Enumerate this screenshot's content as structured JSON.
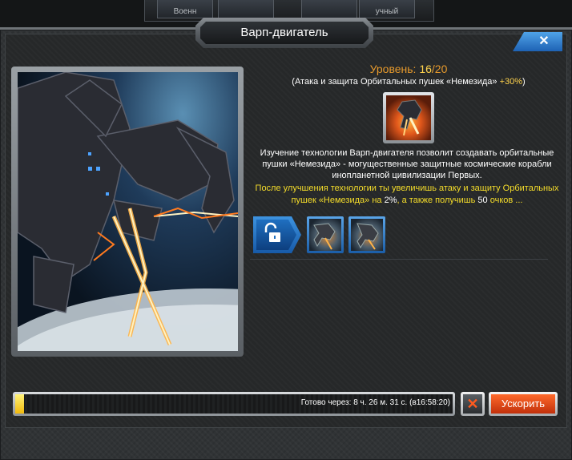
{
  "top_tabs": [
    "Военн",
    "",
    "",
    "учный"
  ],
  "window": {
    "title": "Варп-двигатель",
    "close_label": "✕"
  },
  "level": {
    "label": "Уровень:",
    "current": "16",
    "separator": "/",
    "max": "20"
  },
  "bonus": {
    "prefix": "(Атака и защита Орбитальных пушек «Немезида» ",
    "value": "+30%",
    "suffix": ")"
  },
  "description": "Изучение технологии Варп-двигателя позволит создавать орбитальные пушки «Немезида» - могущественные защитные космические корабли инопланетной цивилизации Первых.",
  "upgrade_info": {
    "part1": "После улучшения технологии ты увеличишь атаку и защиту Орбитальных пушек «Немезида» на ",
    "percent": "2%",
    "part2": ", а также получишь ",
    "points": "50",
    "part3": " очков ..."
  },
  "progress": {
    "fraction": 0.02,
    "text": "Готово через: 8 ч. 26 м. 31 с. (в16:58:20)"
  },
  "buttons": {
    "cancel_label": "✕",
    "speed_up_label": "Ускорить"
  },
  "colors": {
    "accent_orange": "#e79a2c",
    "highlight_yellow": "#f5dd2a",
    "button_blue": "#1e62b4",
    "button_red": "#c1300b"
  },
  "icons": [
    "close-icon",
    "lock-icon",
    "unit-icon",
    "cancel-icon"
  ]
}
